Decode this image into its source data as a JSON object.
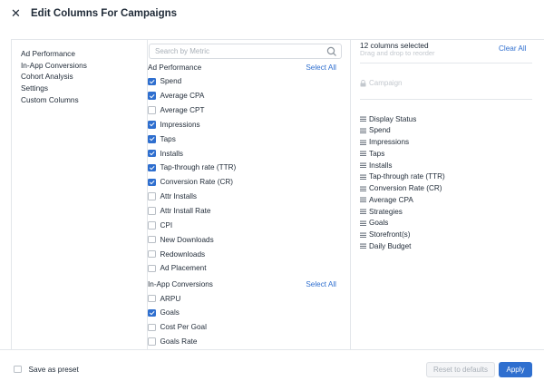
{
  "header": {
    "close_icon": "close-icon",
    "title": "Edit Columns For Campaigns"
  },
  "nav": {
    "items": [
      "Ad Performance",
      "In-App Conversions",
      "Cohort Analysis",
      "Settings",
      "Custom Columns"
    ]
  },
  "search": {
    "placeholder": "Search by Metric",
    "icon": "search-icon"
  },
  "sections": [
    {
      "title": "Ad Performance",
      "select_all": "Select All",
      "items": [
        {
          "label": "Spend",
          "checked": true
        },
        {
          "label": "Average CPA",
          "checked": true
        },
        {
          "label": "Average CPT",
          "checked": false
        },
        {
          "label": "Impressions",
          "checked": true
        },
        {
          "label": "Taps",
          "checked": true
        },
        {
          "label": "Installs",
          "checked": true
        },
        {
          "label": "Tap-through rate (TTR)",
          "checked": true
        },
        {
          "label": "Conversion Rate (CR)",
          "checked": true
        },
        {
          "label": "Attr Installs",
          "checked": false
        },
        {
          "label": "Attr Install Rate",
          "checked": false
        },
        {
          "label": "CPI",
          "checked": false
        },
        {
          "label": "New Downloads",
          "checked": false
        },
        {
          "label": "Redownloads",
          "checked": false
        },
        {
          "label": "Ad Placement",
          "checked": false
        }
      ]
    },
    {
      "title": "In-App Conversions",
      "select_all": "Select All",
      "items": [
        {
          "label": "ARPU",
          "checked": false
        },
        {
          "label": "Goals",
          "checked": true
        },
        {
          "label": "Cost Per Goal",
          "checked": false
        },
        {
          "label": "Goals Rate",
          "checked": false
        }
      ]
    }
  ],
  "selected": {
    "count_text": "12 columns selected",
    "hint": "Drag and drop to reorder",
    "clear_all": "Clear All",
    "locked_item": "Campaign",
    "locked_icon": "lock-icon",
    "handle_icon": "drag-handle-icon",
    "items": [
      "Display Status",
      "Spend",
      "Impressions",
      "Taps",
      "Installs",
      "Tap-through rate (TTR)",
      "Conversion Rate (CR)",
      "Average CPA",
      "Strategies",
      "Goals",
      "Storefront(s)",
      "Daily Budget"
    ]
  },
  "footer": {
    "save_preset": "Save as preset",
    "save_preset_checked": false,
    "reset": "Reset to defaults",
    "apply": "Apply"
  },
  "colors": {
    "accent": "#2f6fcf",
    "text": "#1f2a37",
    "muted": "#a9b0b8",
    "border": "#e3e6ea"
  }
}
